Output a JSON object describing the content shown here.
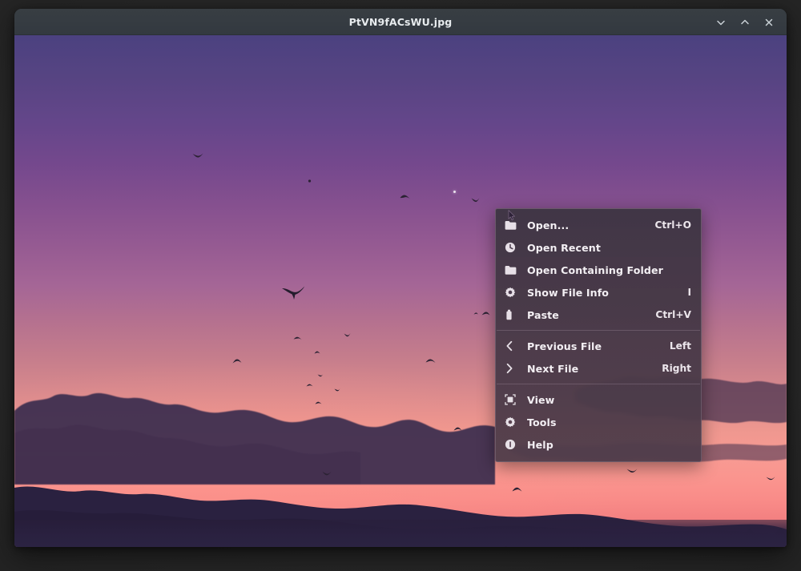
{
  "window": {
    "title": "PtVN9fACsWU.jpg",
    "controls": [
      {
        "name": "minimize-button",
        "icon": "chevron-down-icon",
        "label": "Minimize"
      },
      {
        "name": "maximize-button",
        "icon": "chevron-up-icon",
        "label": "Maximize"
      },
      {
        "name": "close-button",
        "icon": "close-icon",
        "label": "Close"
      }
    ]
  },
  "image": {
    "description": "Sunset sky with flock of birds over a dark mountain ridge",
    "colors": {
      "sky_top": "#4b4180",
      "sky_mid": "#a56696",
      "sky_low": "#f89b93",
      "horizon": "#e8727a",
      "ridge": "#2a2140"
    }
  },
  "context_menu": {
    "accent": "#483c48",
    "groups": [
      {
        "items": [
          {
            "icon": "folder-open-icon",
            "label": "Open...",
            "accel": "Ctrl+O",
            "submenu": false
          },
          {
            "icon": "clock-icon",
            "label": "Open Recent",
            "accel": "",
            "submenu": true
          },
          {
            "icon": "folder-icon",
            "label": "Open Containing Folder",
            "accel": "",
            "submenu": false
          },
          {
            "icon": "gear-icon",
            "label": "Show File Info",
            "accel": "I",
            "submenu": false
          },
          {
            "icon": "paste-icon",
            "label": "Paste",
            "accel": "Ctrl+V",
            "submenu": false
          }
        ]
      },
      {
        "items": [
          {
            "icon": "chevron-left-icon",
            "label": "Previous File",
            "accel": "Left",
            "submenu": false
          },
          {
            "icon": "chevron-right-icon",
            "label": "Next File",
            "accel": "Right",
            "submenu": false
          }
        ]
      },
      {
        "items": [
          {
            "icon": "view-icon",
            "label": "View",
            "accel": "",
            "submenu": true
          },
          {
            "icon": "gear-icon",
            "label": "Tools",
            "accel": "",
            "submenu": true
          },
          {
            "icon": "info-icon",
            "label": "Help",
            "accel": "",
            "submenu": true
          }
        ]
      }
    ]
  }
}
